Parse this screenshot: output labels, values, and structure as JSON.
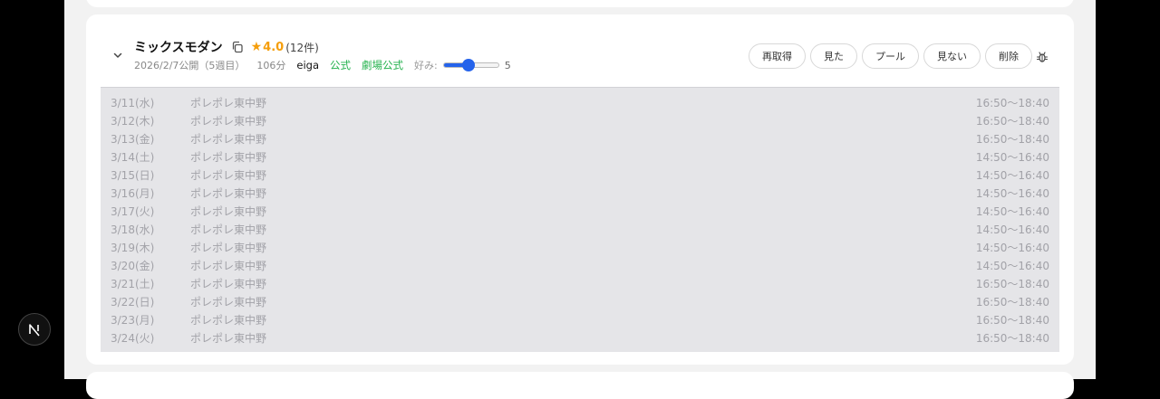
{
  "movie": {
    "title": "ミックスモダン",
    "rating": {
      "value": "4.0",
      "count": "(12件)"
    },
    "release": "2026/2/7公開（5週目）",
    "runtime": "106分",
    "source": "eiga",
    "official_link": "公式",
    "theater_official_link": "劇場公式",
    "preference": {
      "label": "好み:",
      "value": 5,
      "fill_percent": 45
    }
  },
  "actions": {
    "refetch": "再取得",
    "watched": "見た",
    "pool": "プール",
    "skip": "見ない",
    "delete": "削除"
  },
  "schedule": [
    {
      "date": "3/11(水)",
      "theater": "ポレポレ東中野",
      "time": "16:50〜18:40"
    },
    {
      "date": "3/12(木)",
      "theater": "ポレポレ東中野",
      "time": "16:50〜18:40"
    },
    {
      "date": "3/13(金)",
      "theater": "ポレポレ東中野",
      "time": "16:50〜18:40"
    },
    {
      "date": "3/14(土)",
      "theater": "ポレポレ東中野",
      "time": "14:50〜16:40"
    },
    {
      "date": "3/15(日)",
      "theater": "ポレポレ東中野",
      "time": "14:50〜16:40"
    },
    {
      "date": "3/16(月)",
      "theater": "ポレポレ東中野",
      "time": "14:50〜16:40"
    },
    {
      "date": "3/17(火)",
      "theater": "ポレポレ東中野",
      "time": "14:50〜16:40"
    },
    {
      "date": "3/18(水)",
      "theater": "ポレポレ東中野",
      "time": "14:50〜16:40"
    },
    {
      "date": "3/19(木)",
      "theater": "ポレポレ東中野",
      "time": "14:50〜16:40"
    },
    {
      "date": "3/20(金)",
      "theater": "ポレポレ東中野",
      "time": "14:50〜16:40"
    },
    {
      "date": "3/21(土)",
      "theater": "ポレポレ東中野",
      "time": "16:50〜18:40"
    },
    {
      "date": "3/22(日)",
      "theater": "ポレポレ東中野",
      "time": "16:50〜18:40"
    },
    {
      "date": "3/23(月)",
      "theater": "ポレポレ東中野",
      "time": "16:50〜18:40"
    },
    {
      "date": "3/24(火)",
      "theater": "ポレポレ東中野",
      "time": "16:50〜18:40"
    }
  ],
  "dev_badge": {
    "letter": "N"
  },
  "icons": {
    "collapse": "chevron-down-icon",
    "copy": "copy-icon",
    "star": "star-icon",
    "debug": "bug-icon"
  },
  "colors": {
    "accent": "#2563eb",
    "rating": "#f59e0b",
    "link": "#22b14c",
    "schedule_bg": "#e5e5e8"
  }
}
